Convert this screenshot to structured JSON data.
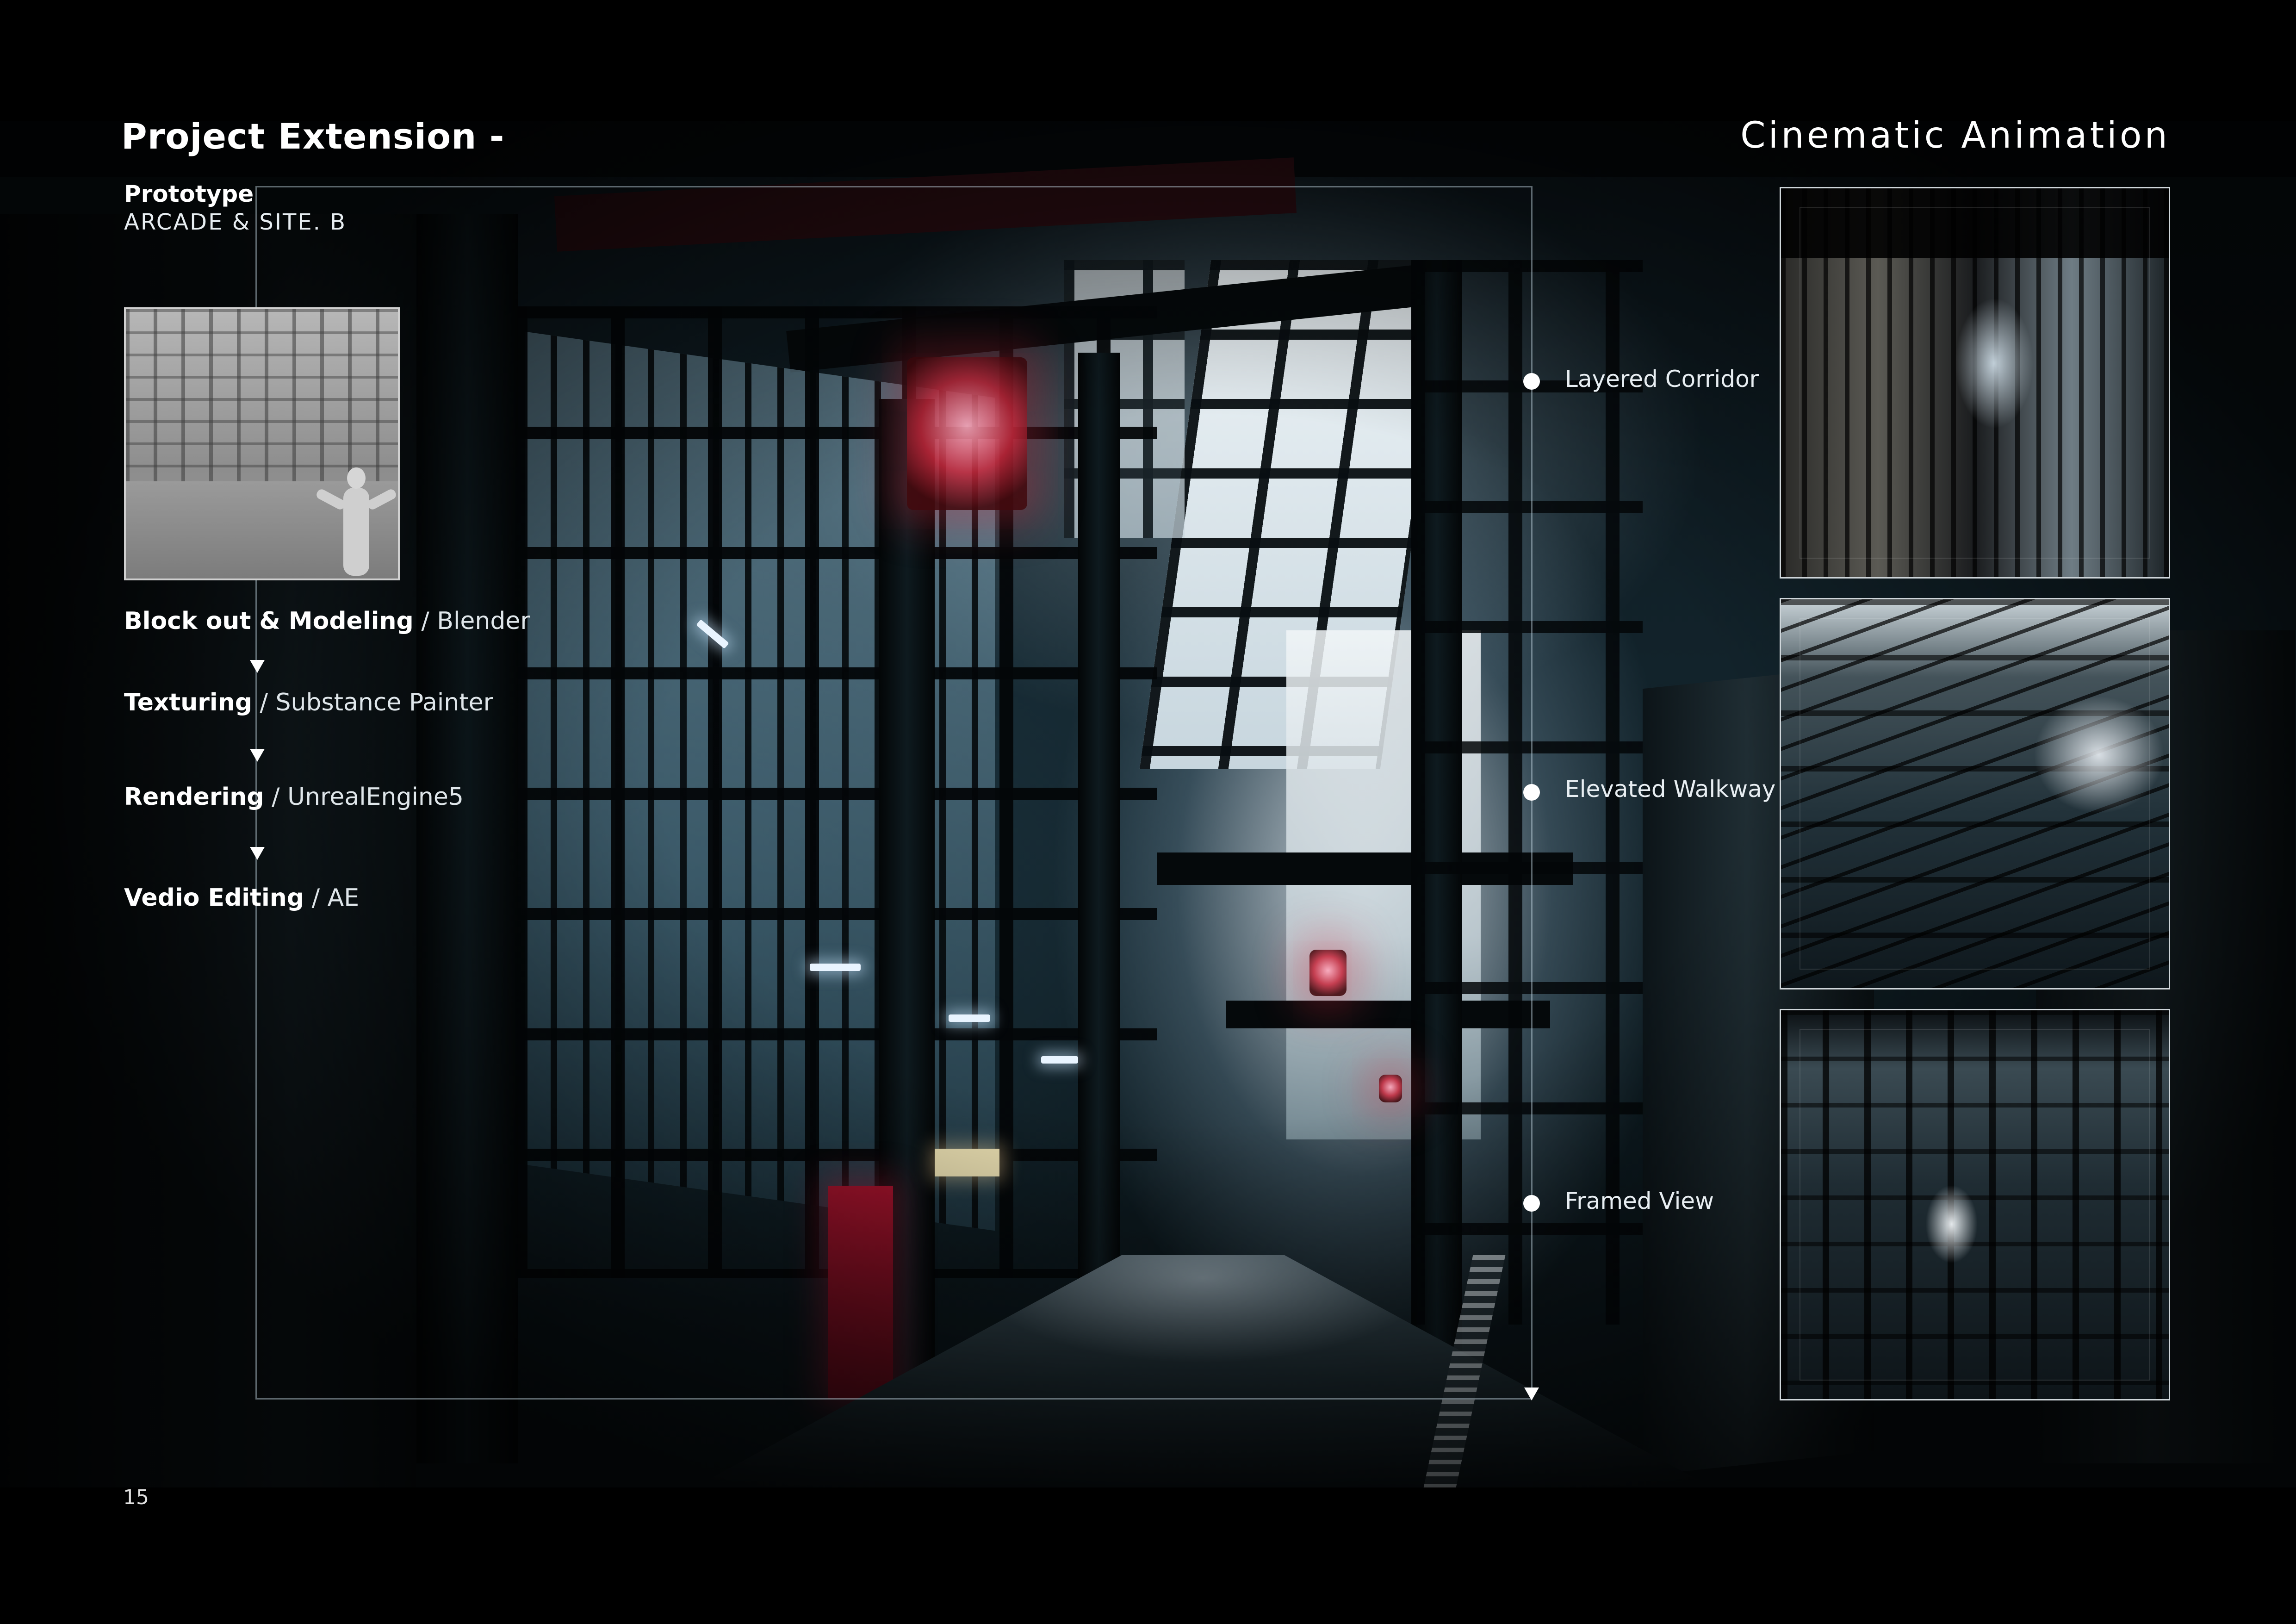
{
  "header": {
    "title": "Project Extension -",
    "subtitle": "Cinematic  Animation"
  },
  "prototype": {
    "label": "Prototype",
    "sub": "ARCADE  &  SITE. B"
  },
  "workflow": [
    {
      "bold": "Block out  &  Modeling",
      "tool": " / Blender"
    },
    {
      "bold": "Texturing",
      "tool": " / Substance Painter"
    },
    {
      "bold": "Rendering",
      "tool": " / UnrealEngine5"
    },
    {
      "bold": "Vedio Editing",
      "tool": " / AE"
    }
  ],
  "markers": [
    {
      "label": "Layered Corridor"
    },
    {
      "label": "Elevated Walkway"
    },
    {
      "label": "Framed View"
    }
  ],
  "footer": {
    "page_number": "15"
  },
  "colors": {
    "background": "#000000",
    "text": "#ffffff",
    "frame": "#c8dce6",
    "accent_red": "#a3132c"
  },
  "icons": {
    "workflow_arrow": "arrow-down-icon",
    "marker": "dot-icon"
  }
}
